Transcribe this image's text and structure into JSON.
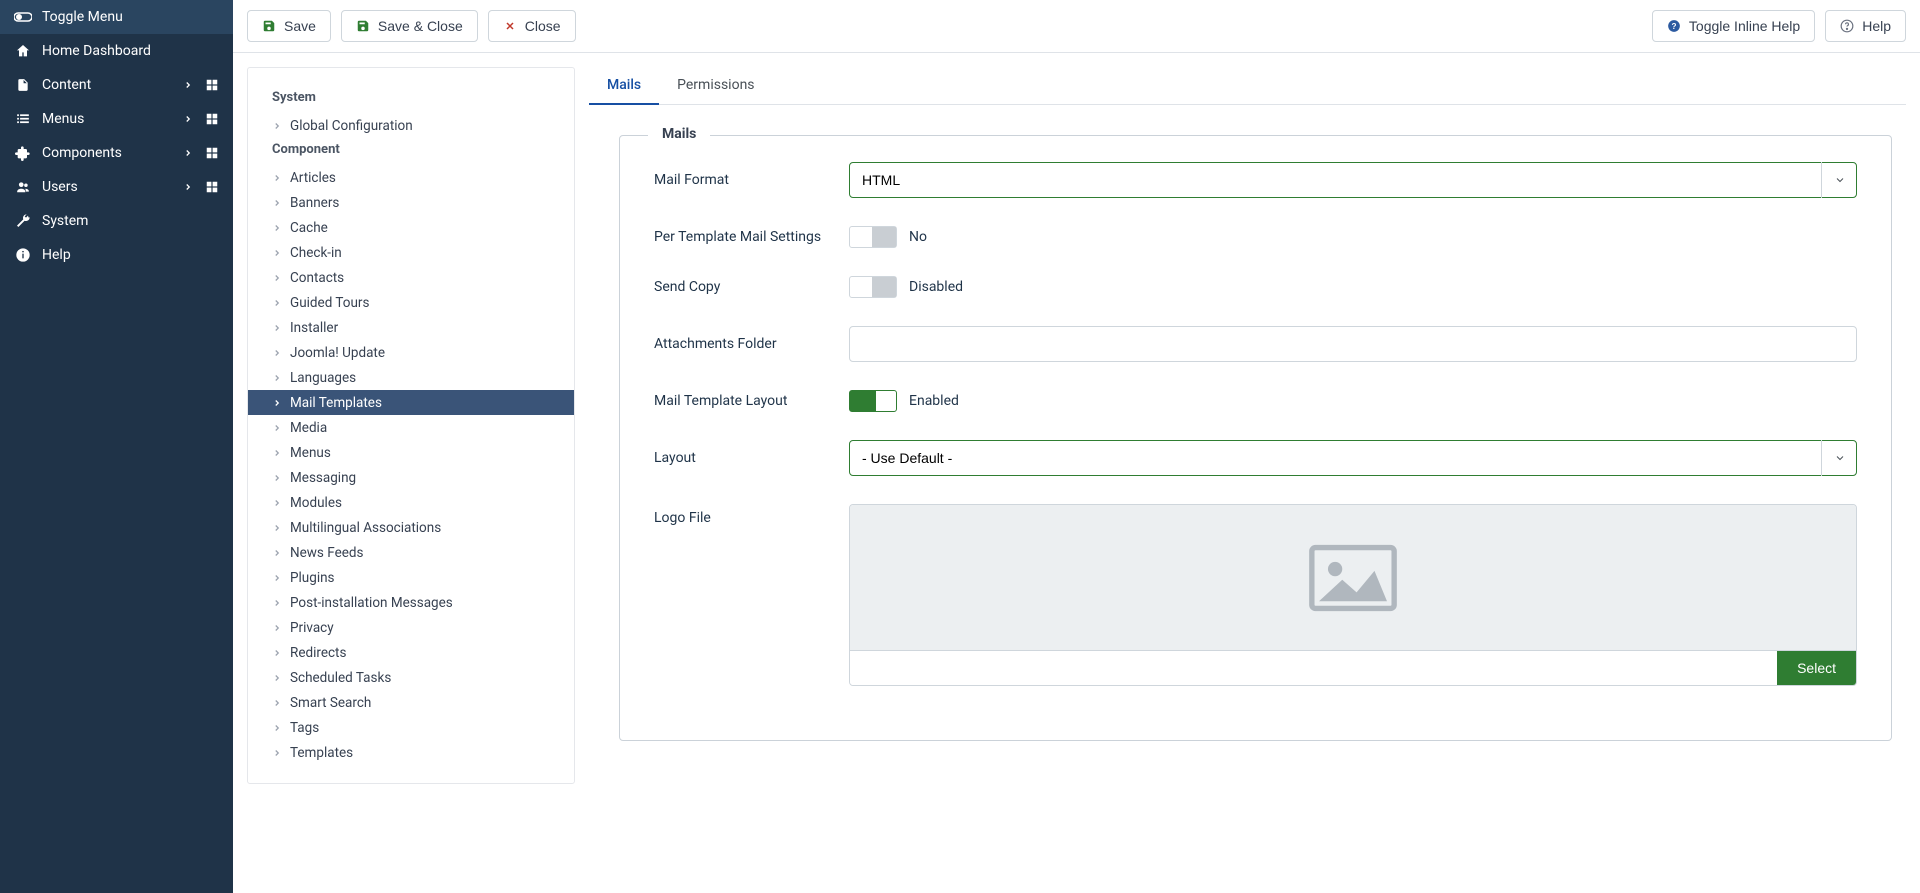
{
  "sidebar": {
    "toggle": "Toggle Menu",
    "items": [
      {
        "label": "Home Dashboard",
        "icon": "home"
      },
      {
        "label": "Content",
        "icon": "file",
        "sub": true
      },
      {
        "label": "Menus",
        "icon": "list",
        "sub": true
      },
      {
        "label": "Components",
        "icon": "puzzle",
        "sub": true
      },
      {
        "label": "Users",
        "icon": "users",
        "sub": true
      },
      {
        "label": "System",
        "icon": "wrench"
      },
      {
        "label": "Help",
        "icon": "info"
      }
    ]
  },
  "toolbar": {
    "save": "Save",
    "save_close": "Save & Close",
    "close": "Close",
    "toggle_help": "Toggle Inline Help",
    "help": "Help"
  },
  "config_sidebar": {
    "groups": [
      {
        "title": "System",
        "items": [
          "Global Configuration"
        ]
      },
      {
        "title": "Component",
        "items": [
          "Articles",
          "Banners",
          "Cache",
          "Check-in",
          "Contacts",
          "Guided Tours",
          "Installer",
          "Joomla! Update",
          "Languages",
          "Mail Templates",
          "Media",
          "Menus",
          "Messaging",
          "Modules",
          "Multilingual Associations",
          "News Feeds",
          "Plugins",
          "Post-installation Messages",
          "Privacy",
          "Redirects",
          "Scheduled Tasks",
          "Smart Search",
          "Tags",
          "Templates"
        ],
        "active": "Mail Templates"
      }
    ]
  },
  "tabs": [
    "Mails",
    "Permissions"
  ],
  "active_tab": "Mails",
  "fieldset": {
    "legend": "Mails",
    "mail_format": {
      "label": "Mail Format",
      "value": "HTML"
    },
    "per_template": {
      "label": "Per Template Mail Settings",
      "value": "No",
      "on": false
    },
    "send_copy": {
      "label": "Send Copy",
      "value": "Disabled",
      "on": false
    },
    "attachments": {
      "label": "Attachments Folder",
      "value": ""
    },
    "template_layout": {
      "label": "Mail Template Layout",
      "value": "Enabled",
      "on": true
    },
    "layout": {
      "label": "Layout",
      "value": "- Use Default -"
    },
    "logo": {
      "label": "Logo File",
      "select": "Select"
    }
  }
}
